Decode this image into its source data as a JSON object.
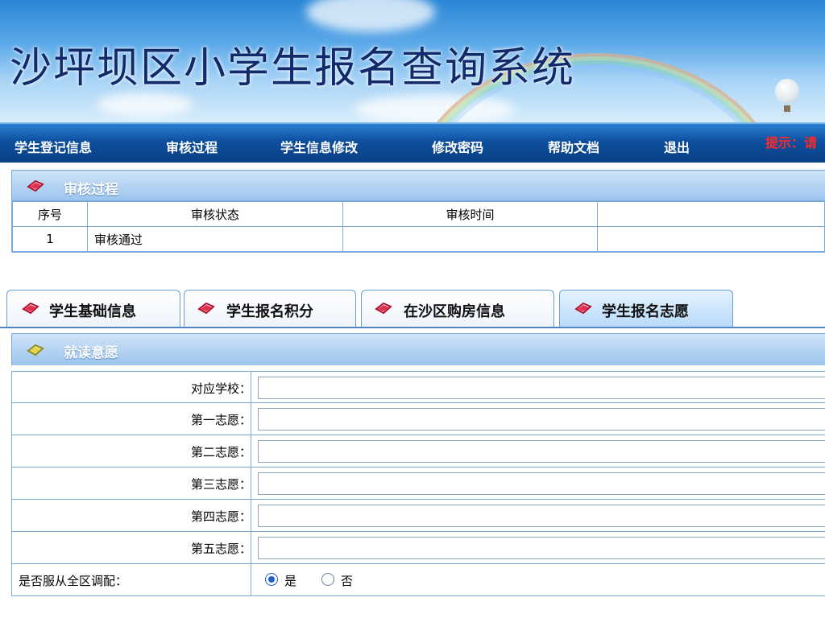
{
  "header": {
    "title": "沙坪坝区小学生报名查询系统"
  },
  "nav": {
    "items": [
      {
        "label": "学生登记信息"
      },
      {
        "label": "审核过程"
      },
      {
        "label": "学生信息修改"
      },
      {
        "label": "修改密码"
      },
      {
        "label": "帮助文档"
      },
      {
        "label": "退出"
      }
    ],
    "tip": "提示：请"
  },
  "audit": {
    "title": "审核过程",
    "columns": [
      "序号",
      "审核状态",
      "审核时间",
      ""
    ],
    "rows": [
      {
        "no": "1",
        "status": "审核通过",
        "time": "",
        "extra": ""
      }
    ]
  },
  "tabs": [
    {
      "label": "学生基础信息"
    },
    {
      "label": "学生报名积分"
    },
    {
      "label": "在沙区购房信息"
    },
    {
      "label": "学生报名志愿",
      "active": true
    }
  ],
  "intent": {
    "title": "就读意愿",
    "fields": [
      {
        "label": "对应学校：",
        "value": ""
      },
      {
        "label": "第一志愿：",
        "value": ""
      },
      {
        "label": "第二志愿：",
        "value": ""
      },
      {
        "label": "第三志愿：",
        "value": ""
      },
      {
        "label": "第四志愿：",
        "value": ""
      },
      {
        "label": "第五志愿：",
        "value": ""
      }
    ],
    "obey": {
      "label": "是否服从全区调配：",
      "options": [
        "是",
        "否"
      ],
      "selected": "是"
    }
  },
  "colors": {
    "nav_bg": "#0d4f9e",
    "panel_head": "#9cc4ee",
    "border": "#7aa9dd",
    "tip": "#ff2a2a"
  }
}
